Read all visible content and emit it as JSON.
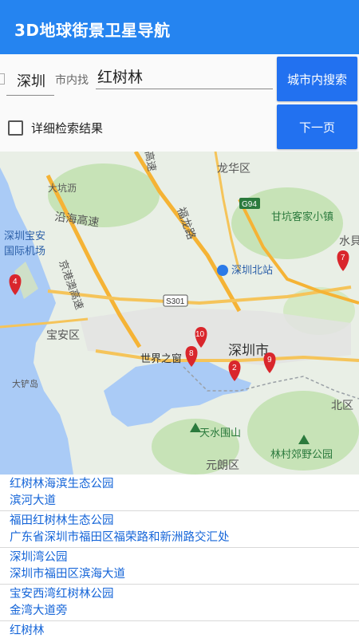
{
  "app": {
    "title": "3D地球街景卫星导航"
  },
  "search": {
    "city_value": "深圳",
    "in_city_label": "市内找",
    "keyword_value": "红树林",
    "search_button": "城市内搜索",
    "next_button": "下一页",
    "detail_label": "详细检索结果",
    "detail_checked": false
  },
  "map": {
    "labels": {
      "longhua": "龙华区",
      "dakang": "大坑沥",
      "yanhai": "沿海高速",
      "airport1": "深圳宝安",
      "airport2": "国际机场",
      "baoan": "宝安区",
      "dachan": "大铲岛",
      "shenzhen": "深圳市",
      "north_station": "深圳北站",
      "ganken": "甘坑客家小镇",
      "shuibei": "水貝",
      "world": "世界之窗",
      "tianshui": "天水围山",
      "linkun": "林村郊野公园",
      "yuanlang": "元朗区",
      "beiqu": "北区",
      "fulong": "福龙路",
      "jing": "京港澳高速",
      "g94": "G94",
      "s301": "S301",
      "gaosu": "高速"
    },
    "markers": [
      "10",
      "8",
      "2",
      "9",
      "4",
      "7"
    ]
  },
  "results": [
    {
      "name": "红树林海滨生态公园",
      "address": "滨河大道"
    },
    {
      "name": "福田红树林生态公园",
      "address": "广东省深圳市福田区福荣路和新洲路交汇处"
    },
    {
      "name": "深圳湾公园",
      "address": "深圳市福田区滨海大道"
    },
    {
      "name": "宝安西湾红树林公园",
      "address": "金湾大道旁"
    },
    {
      "name": "红树林",
      "address": ""
    }
  ],
  "colors": {
    "appbar": "#2584f0",
    "button": "#2271f0",
    "link": "#1565d8",
    "marker": "#d9262c"
  }
}
